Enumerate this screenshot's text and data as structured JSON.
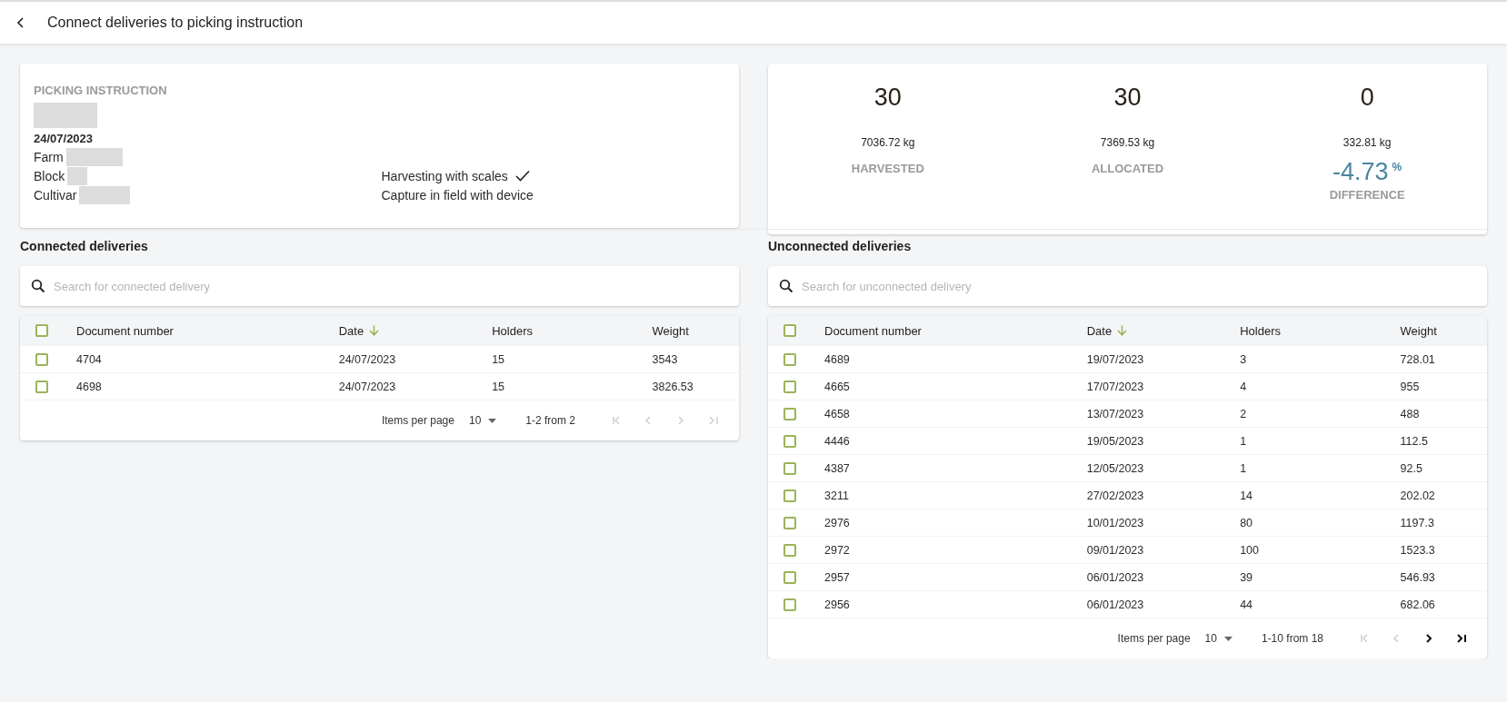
{
  "header": {
    "title": "Connect deliveries to picking instruction"
  },
  "picking_instruction": {
    "heading": "PICKING INSTRUCTION",
    "date": "24/07/2023",
    "fields": [
      {
        "label": "Farm"
      },
      {
        "label": "Block"
      },
      {
        "label": "Cultivar"
      }
    ],
    "options": [
      {
        "label": "Harvesting with scales",
        "checked": true
      },
      {
        "label": "Capture in field with device",
        "checked": false
      }
    ]
  },
  "summary": [
    {
      "count": "30",
      "weight": "7036.72 kg",
      "label": "HARVESTED"
    },
    {
      "count": "30",
      "weight": "7369.53 kg",
      "label": "ALLOCATED"
    },
    {
      "count": "0",
      "weight": "332.81 kg",
      "percentage": "-4.73",
      "unit": "%",
      "label": "DIFFERENCE"
    }
  ],
  "panels": [
    {
      "title": "Connected deliveries",
      "search": {
        "placeholder": "Search for connected delivery"
      },
      "table": {
        "select_all": {
          "checked": false
        },
        "columns": [
          {
            "label": "Document number",
            "sorted": false
          },
          {
            "label": "Date",
            "sorted": true
          },
          {
            "label": "Holders",
            "sorted": false
          },
          {
            "label": "Weight",
            "sorted": false
          }
        ],
        "rows": [
          {
            "checked": false,
            "cells": [
              "4704",
              "24/07/2023",
              "15",
              "3543"
            ]
          },
          {
            "checked": false,
            "cells": [
              "4698",
              "24/07/2023",
              "15",
              "3826.53"
            ]
          }
        ]
      },
      "paginator": {
        "items_per_page_label": "Items per page",
        "page_size": "10",
        "range": "1-2 from 2",
        "buttons": [
          {
            "kind": "first",
            "disabled": true
          },
          {
            "kind": "previous",
            "disabled": true
          },
          {
            "kind": "next",
            "disabled": true
          },
          {
            "kind": "last",
            "disabled": true
          }
        ]
      }
    },
    {
      "title": "Unconnected deliveries",
      "search": {
        "placeholder": "Search for unconnected delivery"
      },
      "table": {
        "select_all": {
          "checked": false
        },
        "columns": [
          {
            "label": "Document number",
            "sorted": false
          },
          {
            "label": "Date",
            "sorted": true
          },
          {
            "label": "Holders",
            "sorted": false
          },
          {
            "label": "Weight",
            "sorted": false
          }
        ],
        "rows": [
          {
            "checked": false,
            "cells": [
              "4689",
              "19/07/2023",
              "3",
              "728.01"
            ]
          },
          {
            "checked": false,
            "cells": [
              "4665",
              "17/07/2023",
              "4",
              "955"
            ]
          },
          {
            "checked": false,
            "cells": [
              "4658",
              "13/07/2023",
              "2",
              "488"
            ]
          },
          {
            "checked": false,
            "cells": [
              "4446",
              "19/05/2023",
              "1",
              "112.5"
            ]
          },
          {
            "checked": false,
            "cells": [
              "4387",
              "12/05/2023",
              "1",
              "92.5"
            ]
          },
          {
            "checked": false,
            "cells": [
              "3211",
              "27/02/2023",
              "14",
              "202.02"
            ]
          },
          {
            "checked": false,
            "cells": [
              "2976",
              "10/01/2023",
              "80",
              "1197.3"
            ]
          },
          {
            "checked": false,
            "cells": [
              "2972",
              "09/01/2023",
              "100",
              "1523.3"
            ]
          },
          {
            "checked": false,
            "cells": [
              "2957",
              "06/01/2023",
              "39",
              "546.93"
            ]
          },
          {
            "checked": false,
            "cells": [
              "2956",
              "06/01/2023",
              "44",
              "682.06"
            ]
          }
        ]
      },
      "paginator": {
        "items_per_page_label": "Items per page",
        "page_size": "10",
        "range": "1-10 from 18",
        "buttons": [
          {
            "kind": "first",
            "disabled": true
          },
          {
            "kind": "previous",
            "disabled": true
          },
          {
            "kind": "next",
            "disabled": false
          },
          {
            "kind": "last",
            "disabled": false
          }
        ]
      }
    }
  ]
}
